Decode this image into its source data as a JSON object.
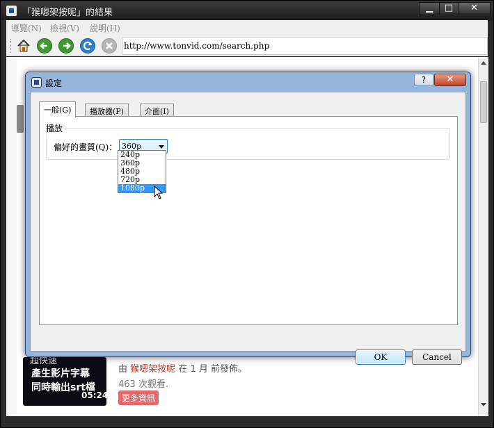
{
  "window": {
    "title": "「猴嗯架按呢」的結果",
    "minimize": "▁",
    "maximize": "□",
    "close": "✕"
  },
  "menu": {
    "items": [
      "導覽(N)",
      "檢視(V)",
      "說明(H)"
    ]
  },
  "toolbar": {
    "url": "http://www.tonvid.com/search.php",
    "icons": [
      "home-icon",
      "back-icon",
      "forward-icon",
      "refresh-icon",
      "stop-icon"
    ]
  },
  "dialog": {
    "title": "設定",
    "help_label": "?",
    "close_label": "✕",
    "tabs": [
      "一般(G)",
      "播放器(P)",
      "介面(I)"
    ],
    "active_tab": "一般(G)",
    "group_title": "播放",
    "quality_label": "偏好的畫質(Q)：",
    "quality_value": "360p",
    "quality_options": [
      "240p",
      "360p",
      "480p",
      "720p",
      "1080p"
    ],
    "highlighted_option": "1080p",
    "ok_label": "OK",
    "cancel_label": "Cancel"
  },
  "background": {
    "thumb_line1": "超快速",
    "thumb_line2": "產生影片字幕",
    "thumb_line3": "同時輸出srt檔",
    "duration": "05:24",
    "meta_prefix": "由",
    "meta_author": "猴嗯架按呢",
    "meta_suffix": "在 1 月 前發佈。",
    "views": "463 次觀看.",
    "more_button": "更多資訊"
  },
  "colors": {
    "dialog_frame": "#8cafd7",
    "accent": "#3399ff",
    "more_button": "#e36a6a"
  }
}
